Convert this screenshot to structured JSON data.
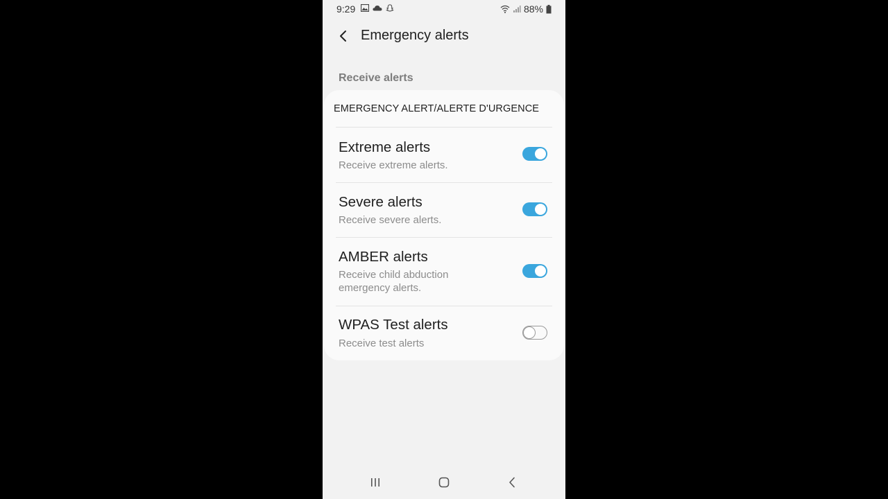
{
  "status_bar": {
    "time": "9:29",
    "battery": "88%"
  },
  "header": {
    "title": "Emergency alerts"
  },
  "section": {
    "label": "Receive alerts"
  },
  "card": {
    "title": "EMERGENCY ALERT/ALERTE D'URGENCE",
    "items": [
      {
        "title": "Extreme alerts",
        "subtitle": "Receive extreme alerts.",
        "enabled": true
      },
      {
        "title": "Severe alerts",
        "subtitle": "Receive severe alerts.",
        "enabled": true
      },
      {
        "title": "AMBER alerts",
        "subtitle": "Receive child abduction emergency alerts.",
        "enabled": true
      },
      {
        "title": "WPAS Test alerts",
        "subtitle": "Receive test alerts",
        "enabled": false
      }
    ]
  },
  "colors": {
    "toggle_on": "#3aa6dd",
    "background": "#f2f2f2",
    "card": "#fafafa"
  },
  "icons": {
    "back": "arrow-left-icon",
    "nav_recents": "recents-icon",
    "nav_home": "home-icon",
    "nav_back": "nav-back-icon"
  }
}
